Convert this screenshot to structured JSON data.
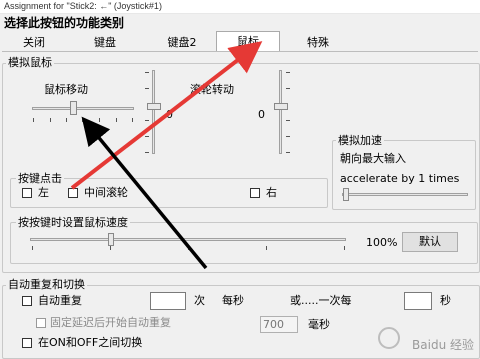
{
  "window": {
    "title": "Assignment for \"Stick2: ←\" (Joystick#1)"
  },
  "heading": "选择此按钮的功能类别",
  "tabs": [
    {
      "label": "关闭"
    },
    {
      "label": "键盘"
    },
    {
      "label": "键盘2"
    },
    {
      "label": "鼠标",
      "active": true
    },
    {
      "label": "特殊"
    }
  ],
  "mouse_sim": {
    "group_label": "模拟鼠标",
    "move_label": "鼠标移动",
    "wheel_label": "滚轮转动",
    "move_value": "0",
    "wheel_value": "0",
    "accel": {
      "group_label": "模拟加速",
      "max_input_label": "朝向最大输入",
      "accel_text": "accelerate by 1 times"
    },
    "buttons": {
      "group_label": "按键点击",
      "left": "左",
      "middle": "中间滚轮",
      "right": "右"
    },
    "speed": {
      "group_label": "按按键时设置鼠标速度",
      "value": "100%",
      "default_button": "默认"
    }
  },
  "auto_repeat": {
    "group_label": "自动重复和切换",
    "auto_repeat_label": "自动重复",
    "times_unit": "次",
    "per_second": "每秒",
    "or_once_per": "或.....一次每",
    "seconds_unit": "秒",
    "times_value": "",
    "seconds_value": "",
    "delay_label": "固定延迟后开始自动重复",
    "delay_value": "700",
    "ms_unit": "毫秒",
    "toggle_label": "在ON和OFF之间切换"
  },
  "watermark": "Baidu 经验",
  "colors": {
    "arrow_red": "#e53935",
    "arrow_black": "#000000",
    "window_bg": "#f0f0f0"
  }
}
